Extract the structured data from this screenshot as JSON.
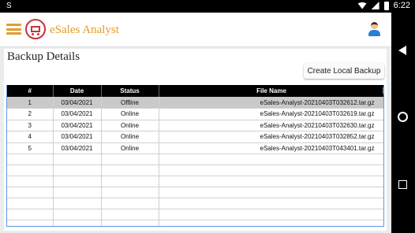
{
  "statusbar": {
    "left_glyph": "S",
    "time": "6:22"
  },
  "header": {
    "app_title": "eSales Analyst"
  },
  "page": {
    "title": "Backup Details",
    "create_button": "Create Local Backup"
  },
  "table": {
    "columns": [
      "#",
      "Date",
      "Status",
      "File Name"
    ],
    "rows": [
      {
        "num": "1",
        "date": "03/04/2021",
        "status": "Offline",
        "file": "eSales-Analyst-20210403T032612.tar.gz"
      },
      {
        "num": "2",
        "date": "03/04/2021",
        "status": "Online",
        "file": "eSales-Analyst-20210403T032619.tar.gz"
      },
      {
        "num": "3",
        "date": "03/04/2021",
        "status": "Online",
        "file": "eSales-Analyst-20210403T032630.tar.gz"
      },
      {
        "num": "4",
        "date": "03/04/2021",
        "status": "Online",
        "file": "eSales-Analyst-20210403T032852.tar.gz"
      },
      {
        "num": "5",
        "date": "03/04/2021",
        "status": "Online",
        "file": "eSales-Analyst-20210403T043401.tar.gz"
      }
    ]
  },
  "colors": {
    "accent": "#e39c2b",
    "logo_red": "#c8323c",
    "header_bg": "#000000",
    "selected_row": "#c9c9c9",
    "grid_border": "#5a9be0"
  },
  "icons": [
    "menu-icon",
    "logo-cart-icon",
    "user-avatar-icon",
    "wifi-icon",
    "signal-icon",
    "battery-icon",
    "nav-back-icon",
    "nav-home-icon",
    "nav-recent-icon"
  ]
}
